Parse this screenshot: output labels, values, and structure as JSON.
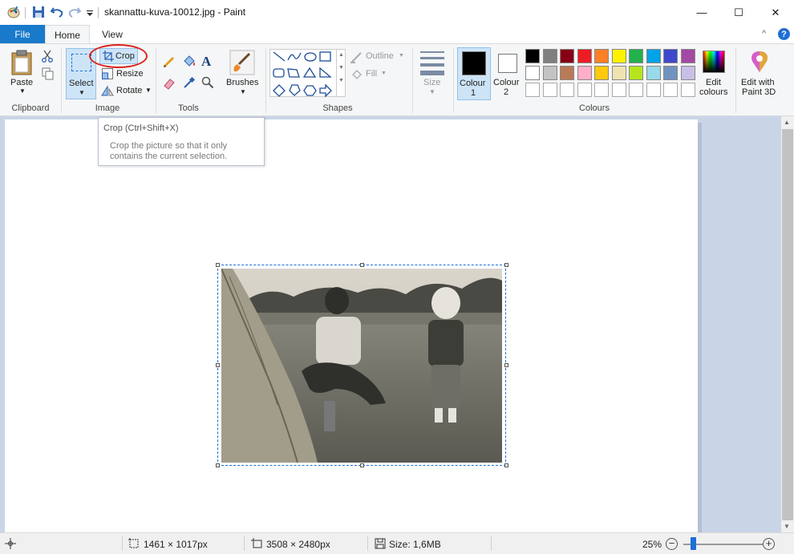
{
  "titlebar": {
    "title": "skannattu-kuva-10012.jpg - Paint",
    "minimize": "—",
    "maximize": "☐",
    "close": "✕"
  },
  "tabs": {
    "file": "File",
    "home": "Home",
    "view": "View"
  },
  "ribbon": {
    "clipboard": {
      "paste": "Paste",
      "group": "Clipboard"
    },
    "image": {
      "select": "Select",
      "crop": "Crop",
      "resize": "Resize",
      "rotate": "Rotate",
      "group": "Image"
    },
    "tools": {
      "group": "Tools",
      "brushes": "Brushes"
    },
    "shapes": {
      "outline": "Outline",
      "fill": "Fill",
      "group": "Shapes"
    },
    "size": "Size",
    "colours": {
      "colour1": "Colour",
      "colour1_num": "1",
      "colour2": "Colour",
      "colour2_num": "2",
      "group": "Colours",
      "edit_colours_1": "Edit",
      "edit_colours_2": "colours",
      "paint3d_1": "Edit with",
      "paint3d_2": "Paint 3D",
      "row1": [
        "#000000",
        "#7f7f7f",
        "#880015",
        "#ed1c24",
        "#ff7f27",
        "#fff200",
        "#22b14c",
        "#00a2e8",
        "#3f48cc",
        "#a349a4"
      ],
      "row2": [
        "#ffffff",
        "#c3c3c3",
        "#b97a57",
        "#ffaec9",
        "#ffc90e",
        "#efe4b0",
        "#b5e61d",
        "#99d9ea",
        "#7092be",
        "#c8bfe7"
      ]
    }
  },
  "tooltip": {
    "title": "Crop (Ctrl+Shift+X)",
    "description": "Crop the picture so that it only contains the current selection."
  },
  "statusbar": {
    "selection_size": "1461 × 1017px",
    "image_size": "3508 × 2480px",
    "file_size": "Size: 1,6MB",
    "zoom": "25%"
  },
  "accent": "#1979ca",
  "highlight_circle": "#d9241c"
}
